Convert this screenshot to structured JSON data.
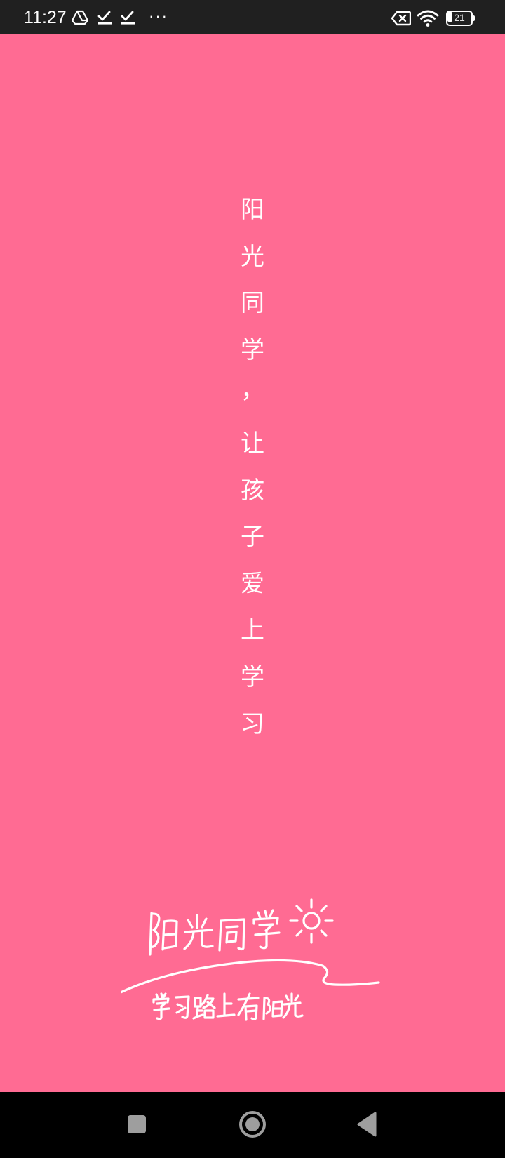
{
  "status_bar": {
    "time": "11:27",
    "left_icons": [
      "drive-icon",
      "check-icon",
      "check-icon",
      "more-dots-icon"
    ],
    "more_label": "···",
    "right_icons": [
      "no-sim-icon",
      "wifi-icon",
      "battery-icon"
    ],
    "battery_level": "21"
  },
  "splash": {
    "background_color": "#ff6b93",
    "slogan": [
      "阳",
      "光",
      "同",
      "学",
      "，",
      "让",
      "孩",
      "子",
      "爱",
      "上",
      "学",
      "习"
    ],
    "logo": {
      "title": "阳光同学",
      "subtitle": "学习路上有阳光",
      "icon": "sun-icon"
    }
  },
  "nav_bar": {
    "buttons": [
      "recents-button",
      "home-button",
      "back-button"
    ]
  }
}
